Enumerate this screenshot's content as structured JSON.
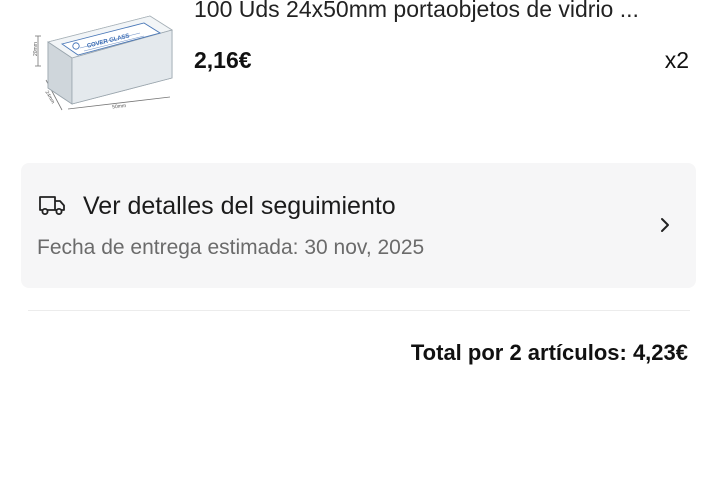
{
  "product": {
    "title": "100 Uds 24x50mm portaobjetos de vidrio ...",
    "price": "2,16€",
    "quantity": "x2",
    "thumbnail": {
      "box_label": "COVER GLASS",
      "dim_height": "20mm",
      "dim_width": "50mm",
      "dim_depth": "24mm"
    }
  },
  "tracking": {
    "title": "Ver detalles del seguimiento",
    "subtitle": "Fecha de entrega estimada: 30 nov, 2025",
    "icon": "truck-icon",
    "chevron": "chevron-right-icon"
  },
  "summary": {
    "total": "Total por 2 artículos: 4,23€"
  },
  "colors": {
    "card_background": "#f6f6f7",
    "primary_text": "#191919",
    "secondary_text": "#6b6b6b"
  }
}
